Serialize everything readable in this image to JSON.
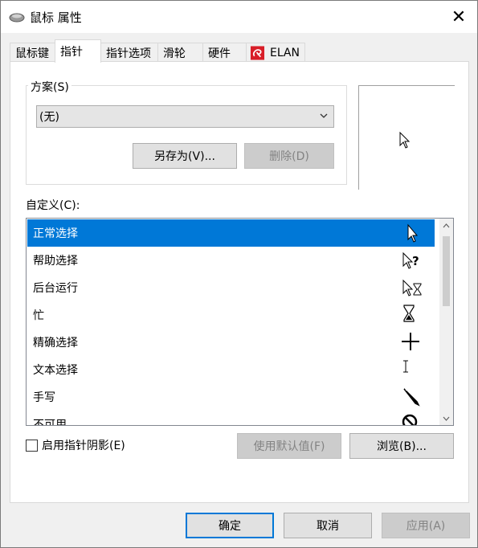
{
  "window": {
    "title": "鼠标 属性",
    "close_glyph": "✕"
  },
  "tabs": [
    {
      "label": "鼠标键"
    },
    {
      "label": "指针"
    },
    {
      "label": "指针选项"
    },
    {
      "label": "滑轮"
    },
    {
      "label": "硬件"
    },
    {
      "label": "ELAN"
    }
  ],
  "scheme": {
    "group_label": "方案(S)",
    "selected_value": "(无)",
    "save_as_label": "另存为(V)...",
    "delete_label": "删除(D)"
  },
  "customize": {
    "label": "自定义(C):",
    "items": [
      {
        "label": "正常选择",
        "icon": "arrow-cursor-icon"
      },
      {
        "label": "帮助选择",
        "icon": "help-cursor-icon"
      },
      {
        "label": "后台运行",
        "icon": "working-in-background-cursor-icon"
      },
      {
        "label": "忙",
        "icon": "hourglass-cursor-icon"
      },
      {
        "label": "精确选择",
        "icon": "crosshair-cursor-icon"
      },
      {
        "label": "文本选择",
        "icon": "text-beam-cursor-icon"
      },
      {
        "label": "手写",
        "icon": "pen-cursor-icon"
      },
      {
        "label": "不可用",
        "icon": "unavailable-cursor-icon"
      }
    ],
    "selected_index": 0
  },
  "options": {
    "shadow_label": "启用指针阴影(E)",
    "shadow_checked": false,
    "use_default_label": "使用默认值(F)",
    "browse_label": "浏览(B)..."
  },
  "footer": {
    "ok_label": "确定",
    "cancel_label": "取消",
    "apply_label": "应用(A)"
  },
  "colors": {
    "selection": "#0078d7",
    "elan_logo": "#d81e28"
  }
}
